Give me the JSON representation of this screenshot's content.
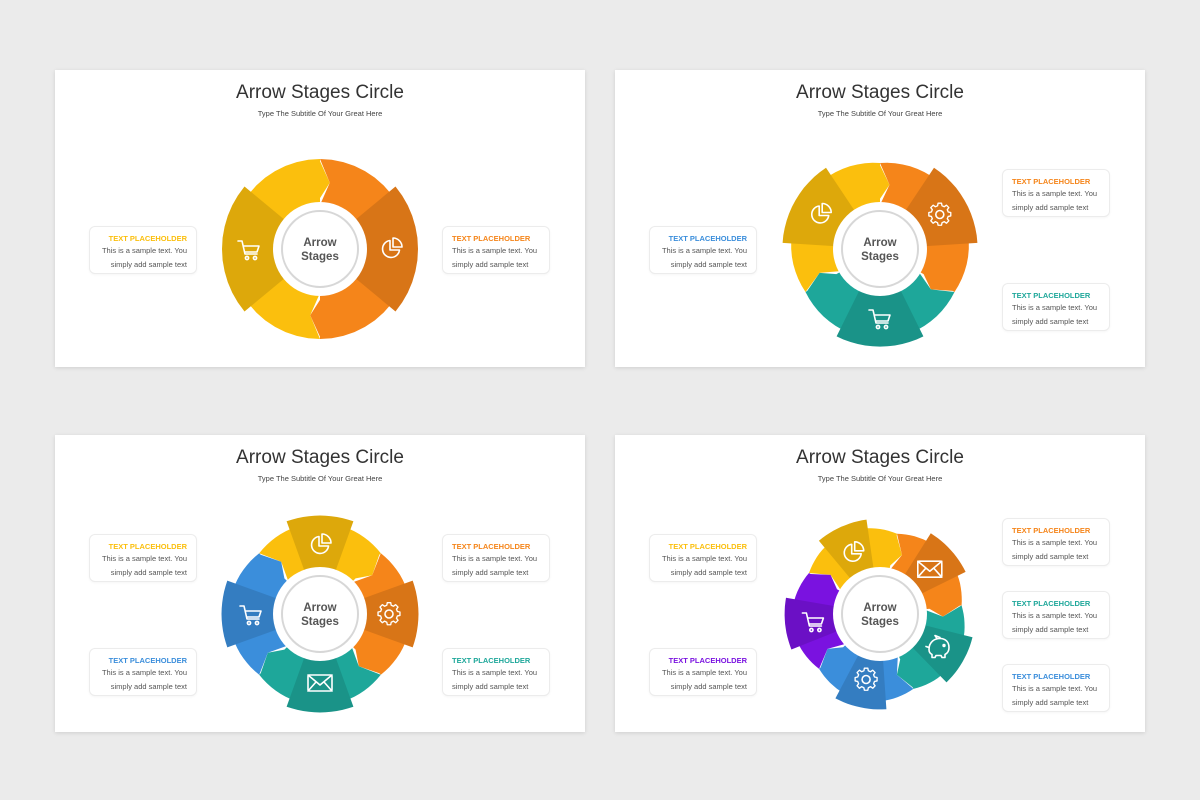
{
  "slides": [
    {
      "title": "Arrow Stages Circle",
      "subtitle": "Type The Subtitle Of Your Great Here",
      "center": [
        "Arrow",
        "Stages"
      ],
      "segments": [
        {
          "color": "#FBBF0D",
          "icon": "cart-icon"
        },
        {
          "color": "#F5851A",
          "icon": "pie-chart-icon"
        }
      ],
      "cards": [
        {
          "heading": "TEXT PLACEHOLDER",
          "heading_color": "#FBBF0D",
          "line1": "This is a sample text. You",
          "line2": "simply add sample text"
        },
        {
          "heading": "TEXT PLACEHOLDER",
          "heading_color": "#F5851A",
          "line1": "This is a sample text. You",
          "line2": "simply add sample text"
        }
      ]
    },
    {
      "title": "Arrow Stages Circle",
      "subtitle": "Type The Subtitle Of Your Great Here",
      "center": [
        "Arrow",
        "Stages"
      ],
      "segments": [
        {
          "color": "#FBBF0D",
          "icon": "pie-chart-icon"
        },
        {
          "color": "#F5851A",
          "icon": "gear-icon"
        },
        {
          "color": "#1EA79A",
          "icon": "cart-icon"
        }
      ],
      "cards": [
        {
          "heading": "TEXT PLACEHOLDER",
          "heading_color": "#3B8EDB",
          "line1": "This is a sample text. You",
          "line2": "simply add sample text"
        },
        {
          "heading": "TEXT PLACEHOLDER",
          "heading_color": "#F5851A",
          "line1": "This is a sample text. You",
          "line2": "simply add sample text"
        },
        {
          "heading": "TEXT PLACEHOLDER",
          "heading_color": "#1EA79A",
          "line1": "This is a sample text. You",
          "line2": "simply add sample text"
        }
      ]
    },
    {
      "title": "Arrow Stages Circle",
      "subtitle": "Type The Subtitle Of Your Great Here",
      "center": [
        "Arrow",
        "Stages"
      ],
      "segments": [
        {
          "color": "#FBBF0D",
          "icon": "pie-chart-icon"
        },
        {
          "color": "#F5851A",
          "icon": "gear-icon"
        },
        {
          "color": "#1EA79A",
          "icon": "envelope-icon"
        },
        {
          "color": "#3B8EDB",
          "icon": "cart-icon"
        }
      ],
      "cards": [
        {
          "heading": "TEXT PLACEHOLDER",
          "heading_color": "#FBBF0D",
          "line1": "This is a sample text. You",
          "line2": "simply add sample text"
        },
        {
          "heading": "TEXT PLACEHOLDER",
          "heading_color": "#F5851A",
          "line1": "This is a sample text. You",
          "line2": "simply add sample text"
        },
        {
          "heading": "TEXT PLACEHOLDER",
          "heading_color": "#3B8EDB",
          "line1": "This is a sample text. You",
          "line2": "simply add sample text"
        },
        {
          "heading": "TEXT PLACEHOLDER",
          "heading_color": "#1EA79A",
          "line1": "This is a sample text. You",
          "line2": "simply add sample text"
        }
      ]
    },
    {
      "title": "Arrow Stages Circle",
      "subtitle": "Type The Subtitle Of Your Great Here",
      "center": [
        "Arrow",
        "Stages"
      ],
      "segments": [
        {
          "color": "#FBBF0D",
          "icon": "pie-chart-icon"
        },
        {
          "color": "#F5851A",
          "icon": "envelope-icon"
        },
        {
          "color": "#1EA79A",
          "icon": "piggy-bank-icon"
        },
        {
          "color": "#3B8EDB",
          "icon": "gear-icon"
        },
        {
          "color": "#7A12E0",
          "icon": "cart-icon"
        }
      ],
      "cards": [
        {
          "heading": "TEXT PLACEHOLDER",
          "heading_color": "#FBBF0D",
          "line1": "This is a sample text. You",
          "line2": "simply add sample text"
        },
        {
          "heading": "TEXT PLACEHOLDER",
          "heading_color": "#7A12E0",
          "line1": "This is a sample text. You",
          "line2": "simply add sample text"
        },
        {
          "heading": "TEXT PLACEHOLDER",
          "heading_color": "#F5851A",
          "line1": "This is a sample text. You",
          "line2": "simply add sample text"
        },
        {
          "heading": "TEXT PLACEHOLDER",
          "heading_color": "#1EA79A",
          "line1": "This is a sample text. You",
          "line2": "simply add sample text"
        },
        {
          "heading": "TEXT PLACEHOLDER",
          "heading_color": "#3B8EDB",
          "line1": "This is a sample text. You",
          "line2": "simply add sample text"
        }
      ]
    }
  ]
}
